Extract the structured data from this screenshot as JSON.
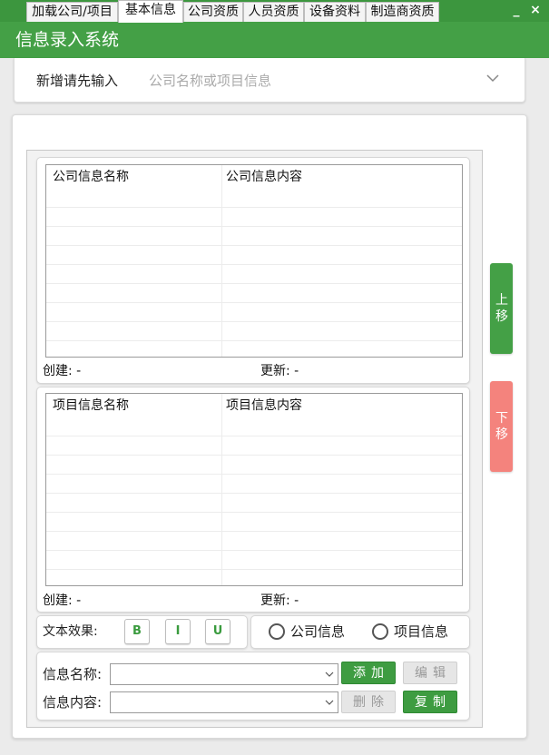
{
  "window": {
    "title": "信息录入系统",
    "minimize_glyph": "_",
    "close_glyph": "×"
  },
  "add_new": {
    "label": "新增请先输入",
    "placeholder": "公司名称或项目信息"
  },
  "tabs": [
    {
      "label": "加载公司/项目"
    },
    {
      "label": "基本信息",
      "active": true
    },
    {
      "label": "公司资质"
    },
    {
      "label": "人员资质"
    },
    {
      "label": "设备资料"
    },
    {
      "label": "制造商资质"
    }
  ],
  "company_grid": {
    "col_name": "公司信息名称",
    "col_content": "公司信息内容",
    "created_label": "创建: -",
    "updated_label": "更新: -"
  },
  "project_grid": {
    "col_name": "项目信息名称",
    "col_content": "项目信息内容",
    "created_label": "创建: -",
    "updated_label": "更新: -"
  },
  "text_effect": {
    "label": "文本效果:",
    "bold": "B",
    "italic": "I",
    "underline": "U"
  },
  "info_type": {
    "company": "公司信息",
    "project": "项目信息"
  },
  "form": {
    "name_label": "信息名称:",
    "content_label": "信息内容:",
    "name_value": "",
    "content_value": "",
    "add_button": "添加",
    "edit_button": "编辑",
    "delete_button": "删除",
    "copy_button": "复制"
  },
  "side": {
    "move_up_1": "上",
    "move_up_2": "移",
    "move_down_1": "下",
    "move_down_2": "移"
  },
  "colors": {
    "accent_green": "#44a046",
    "move_down_red": "#f4837d"
  }
}
